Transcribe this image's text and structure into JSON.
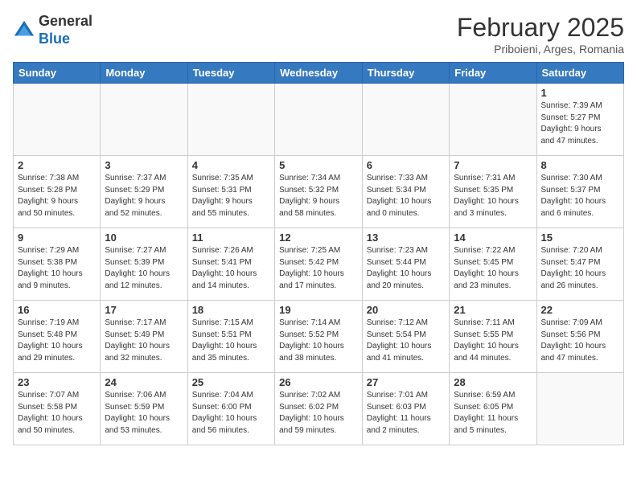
{
  "header": {
    "logo_line1": "General",
    "logo_line2": "Blue",
    "month_year": "February 2025",
    "location": "Priboieni, Arges, Romania"
  },
  "days_of_week": [
    "Sunday",
    "Monday",
    "Tuesday",
    "Wednesday",
    "Thursday",
    "Friday",
    "Saturday"
  ],
  "weeks": [
    [
      {
        "day": "",
        "info": ""
      },
      {
        "day": "",
        "info": ""
      },
      {
        "day": "",
        "info": ""
      },
      {
        "day": "",
        "info": ""
      },
      {
        "day": "",
        "info": ""
      },
      {
        "day": "",
        "info": ""
      },
      {
        "day": "1",
        "info": "Sunrise: 7:39 AM\nSunset: 5:27 PM\nDaylight: 9 hours\nand 47 minutes."
      }
    ],
    [
      {
        "day": "2",
        "info": "Sunrise: 7:38 AM\nSunset: 5:28 PM\nDaylight: 9 hours\nand 50 minutes."
      },
      {
        "day": "3",
        "info": "Sunrise: 7:37 AM\nSunset: 5:29 PM\nDaylight: 9 hours\nand 52 minutes."
      },
      {
        "day": "4",
        "info": "Sunrise: 7:35 AM\nSunset: 5:31 PM\nDaylight: 9 hours\nand 55 minutes."
      },
      {
        "day": "5",
        "info": "Sunrise: 7:34 AM\nSunset: 5:32 PM\nDaylight: 9 hours\nand 58 minutes."
      },
      {
        "day": "6",
        "info": "Sunrise: 7:33 AM\nSunset: 5:34 PM\nDaylight: 10 hours\nand 0 minutes."
      },
      {
        "day": "7",
        "info": "Sunrise: 7:31 AM\nSunset: 5:35 PM\nDaylight: 10 hours\nand 3 minutes."
      },
      {
        "day": "8",
        "info": "Sunrise: 7:30 AM\nSunset: 5:37 PM\nDaylight: 10 hours\nand 6 minutes."
      }
    ],
    [
      {
        "day": "9",
        "info": "Sunrise: 7:29 AM\nSunset: 5:38 PM\nDaylight: 10 hours\nand 9 minutes."
      },
      {
        "day": "10",
        "info": "Sunrise: 7:27 AM\nSunset: 5:39 PM\nDaylight: 10 hours\nand 12 minutes."
      },
      {
        "day": "11",
        "info": "Sunrise: 7:26 AM\nSunset: 5:41 PM\nDaylight: 10 hours\nand 14 minutes."
      },
      {
        "day": "12",
        "info": "Sunrise: 7:25 AM\nSunset: 5:42 PM\nDaylight: 10 hours\nand 17 minutes."
      },
      {
        "day": "13",
        "info": "Sunrise: 7:23 AM\nSunset: 5:44 PM\nDaylight: 10 hours\nand 20 minutes."
      },
      {
        "day": "14",
        "info": "Sunrise: 7:22 AM\nSunset: 5:45 PM\nDaylight: 10 hours\nand 23 minutes."
      },
      {
        "day": "15",
        "info": "Sunrise: 7:20 AM\nSunset: 5:47 PM\nDaylight: 10 hours\nand 26 minutes."
      }
    ],
    [
      {
        "day": "16",
        "info": "Sunrise: 7:19 AM\nSunset: 5:48 PM\nDaylight: 10 hours\nand 29 minutes."
      },
      {
        "day": "17",
        "info": "Sunrise: 7:17 AM\nSunset: 5:49 PM\nDaylight: 10 hours\nand 32 minutes."
      },
      {
        "day": "18",
        "info": "Sunrise: 7:15 AM\nSunset: 5:51 PM\nDaylight: 10 hours\nand 35 minutes."
      },
      {
        "day": "19",
        "info": "Sunrise: 7:14 AM\nSunset: 5:52 PM\nDaylight: 10 hours\nand 38 minutes."
      },
      {
        "day": "20",
        "info": "Sunrise: 7:12 AM\nSunset: 5:54 PM\nDaylight: 10 hours\nand 41 minutes."
      },
      {
        "day": "21",
        "info": "Sunrise: 7:11 AM\nSunset: 5:55 PM\nDaylight: 10 hours\nand 44 minutes."
      },
      {
        "day": "22",
        "info": "Sunrise: 7:09 AM\nSunset: 5:56 PM\nDaylight: 10 hours\nand 47 minutes."
      }
    ],
    [
      {
        "day": "23",
        "info": "Sunrise: 7:07 AM\nSunset: 5:58 PM\nDaylight: 10 hours\nand 50 minutes."
      },
      {
        "day": "24",
        "info": "Sunrise: 7:06 AM\nSunset: 5:59 PM\nDaylight: 10 hours\nand 53 minutes."
      },
      {
        "day": "25",
        "info": "Sunrise: 7:04 AM\nSunset: 6:00 PM\nDaylight: 10 hours\nand 56 minutes."
      },
      {
        "day": "26",
        "info": "Sunrise: 7:02 AM\nSunset: 6:02 PM\nDaylight: 10 hours\nand 59 minutes."
      },
      {
        "day": "27",
        "info": "Sunrise: 7:01 AM\nSunset: 6:03 PM\nDaylight: 11 hours\nand 2 minutes."
      },
      {
        "day": "28",
        "info": "Sunrise: 6:59 AM\nSunset: 6:05 PM\nDaylight: 11 hours\nand 5 minutes."
      },
      {
        "day": "",
        "info": ""
      }
    ]
  ]
}
